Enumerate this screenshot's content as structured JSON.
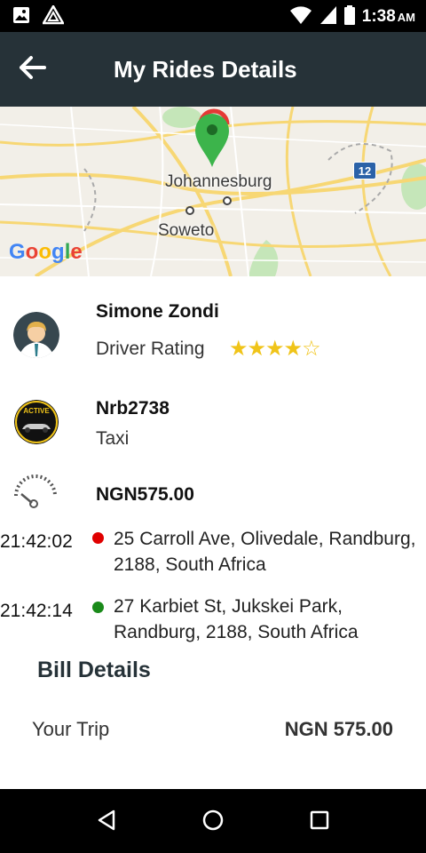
{
  "status_bar": {
    "time": "1:38",
    "ampm": "AM",
    "icons": [
      "image-icon",
      "alert-triangle-icon",
      "wifi-icon",
      "signal-icon",
      "battery-icon"
    ]
  },
  "header": {
    "title": "My Rides Details",
    "back_icon": "arrow-left-icon"
  },
  "map": {
    "labels": {
      "city1": "Johannesburg",
      "city2": "Soweto",
      "highway": "12"
    },
    "brand": {
      "g1": "G",
      "o1": "o",
      "o2": "o",
      "g2": "g",
      "l": "l",
      "e": "e"
    },
    "colors": {
      "pin": "#3cb44b",
      "pin_red": "#e53935",
      "road": "#f7d774",
      "park": "#bfe3b4"
    }
  },
  "driver": {
    "name": "Simone Zondi",
    "rating_label": "Driver Rating",
    "rating": 4,
    "rating_max": 5,
    "stars_filled": "★★★★",
    "stars_empty": "☆"
  },
  "vehicle": {
    "plate": "Nrb2738",
    "type": "Taxi",
    "logo_text": "ACTIVE"
  },
  "fare": {
    "amount": "NGN575.00"
  },
  "trip": {
    "pickup": {
      "time": "21:42:02",
      "address_line1": "25 Carroll Ave, Olivedale, Randburg,",
      "address_line2": "2188, South Africa",
      "dot_color": "#e00000"
    },
    "dropoff": {
      "time": "21:42:14",
      "address_line1": "27 Karbiet St, Jukskei Park,",
      "address_line2": "Randburg, 2188, South Africa",
      "dot_color": "#1a8a1a"
    }
  },
  "bill": {
    "title": "Bill Details",
    "label": "Your Trip",
    "value": "NGN 575.00"
  },
  "nav_bar": {
    "icons": [
      "back-triangle-icon",
      "home-circle-icon",
      "recents-square-icon"
    ]
  }
}
